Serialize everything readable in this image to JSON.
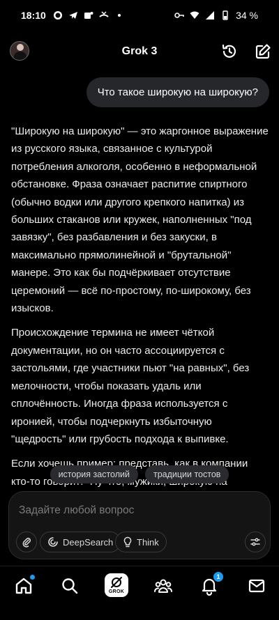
{
  "status_bar": {
    "time": "18:10",
    "battery": "34 %"
  },
  "header": {
    "title": "Grok 3"
  },
  "conversation": {
    "user_message": "Что такое широкую на широкую?",
    "assistant_paragraphs": [
      "\"Широкую на широкую\" — это жаргонное выражение из русского языка, связанное с культурой потребления алкоголя, особенно в неформальной обстановке. Фраза означает распитие спиртного (обычно водки или другого крепкого напитка) из больших стаканов или кружек, наполненных \"под завязку\", без разбавления и без закуски, в максимально прямолинейной и \"брутальной\" манере. Это как бы подчёркивает отсутствие церемоний — всё по-простому, по-широкому, без изысков.",
      "Происхождение термина не имеет чёткой документации, но он часто ассоциируется с застольями, где участники пьют \"на равных\", без мелочности, чтобы показать удаль или сплочённость. Иногда фраза используется с иронией, чтобы подчеркнуть избыточную \"щедрость\" или грубость подхода к выпивке.",
      "Если хочешь пример: представь, как в компании кто-то говорит: \"Ну что, мужики, широкую на широкую?\" — и все бер... залпом. 😊 Это не про утончённость, а про \"широту души\" в..."
    ]
  },
  "suggestions": [
    "история застолий",
    "традиции тостов"
  ],
  "composer": {
    "placeholder": "Задайте любой вопрос",
    "deepsearch_label": "DeepSearch",
    "think_label": "Think"
  },
  "bottom_nav": {
    "grok_label": "GROK",
    "notifications_count": "1"
  },
  "colors": {
    "accent": "#1d9bf0",
    "background": "#000000",
    "bubble": "#26272b"
  }
}
